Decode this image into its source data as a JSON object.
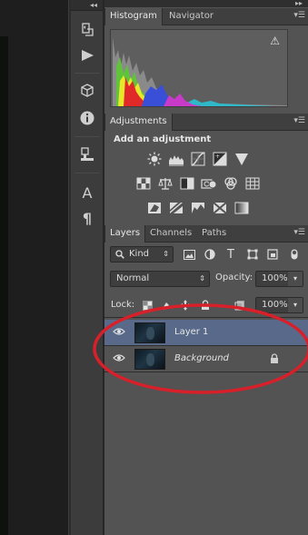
{
  "colors": {
    "panel_bg": "#535353",
    "selected_layer": "#58698a",
    "annotation_ellipse": "#d8202a"
  },
  "tool_strip": {
    "tools": [
      {
        "name": "history-icon"
      },
      {
        "name": "play-actions-icon"
      },
      {
        "name": "3d-cube-icon"
      },
      {
        "name": "info-icon"
      },
      {
        "name": "tool-presets-icon"
      },
      {
        "name": "character-icon",
        "glyph": "A"
      },
      {
        "name": "paragraph-icon",
        "glyph": "¶"
      }
    ]
  },
  "histogram": {
    "tabs": [
      "Histogram",
      "Navigator"
    ],
    "warning": "⚠"
  },
  "adjustments": {
    "tab": "Adjustments",
    "heading": "Add an adjustment"
  },
  "layers_panel": {
    "tabs": [
      "Layers",
      "Channels",
      "Paths"
    ],
    "filter_kind": "Kind",
    "blend_mode": "Normal",
    "opacity_label": "Opacity:",
    "opacity_value": "100%",
    "lock_label": "Lock:",
    "fill_value": "100%",
    "layers": [
      {
        "name": "Layer 1",
        "selected": true,
        "locked": false
      },
      {
        "name": "Background",
        "selected": false,
        "locked": true
      }
    ]
  }
}
